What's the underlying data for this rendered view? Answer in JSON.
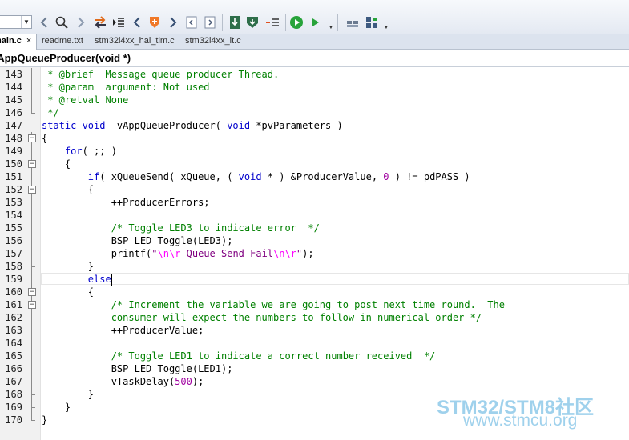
{
  "toolbar": {
    "search_value": "",
    "icons": [
      "back-arrow-icon",
      "find-icon",
      "forward-arrow-icon",
      "indent-icon",
      "outdent-icon",
      "nav-back-icon",
      "bookmark-shield-icon",
      "nav-forward-icon",
      "prev-bookmark-icon",
      "next-bookmark-icon",
      "download-icon",
      "debug-shield-icon",
      "step-icon",
      "run-icon",
      "run-to-cursor-icon",
      "window-layout-icon",
      "window-layout-add-icon"
    ]
  },
  "tabs": [
    {
      "label": "main.c",
      "active": true,
      "close": "×"
    },
    {
      "label": "readme.txt",
      "active": false
    },
    {
      "label": "stm32l4xx_hal_tim.c",
      "active": false
    },
    {
      "label": "stm32l4xx_it.c",
      "active": false
    }
  ],
  "function_bar": "vAppQueueProducer(void *)",
  "code_lines": [
    {
      "n": "143",
      "fold": "line",
      "segs": [
        {
          "t": " * @brief  Message queue producer Thread.",
          "c": "cm"
        }
      ]
    },
    {
      "n": "144",
      "fold": "line",
      "segs": [
        {
          "t": " * @param  argument: Not used",
          "c": "cm"
        }
      ]
    },
    {
      "n": "145",
      "fold": "line",
      "segs": [
        {
          "t": " * @retval None",
          "c": "cm"
        }
      ]
    },
    {
      "n": "146",
      "fold": "end",
      "segs": [
        {
          "t": " */",
          "c": "cm"
        }
      ]
    },
    {
      "n": "147",
      "fold": "none",
      "segs": [
        {
          "t": "static ",
          "c": "kw"
        },
        {
          "t": "void ",
          "c": "kw"
        },
        {
          "t": " vAppQueueProducer( ",
          "c": ""
        },
        {
          "t": "void",
          "c": "kw"
        },
        {
          "t": " *pvParameters )",
          "c": ""
        }
      ]
    },
    {
      "n": "148",
      "fold": "open",
      "segs": [
        {
          "t": "{",
          "c": ""
        }
      ]
    },
    {
      "n": "149",
      "fold": "line",
      "segs": [
        {
          "t": "    ",
          "c": ""
        },
        {
          "t": "for",
          "c": "kw"
        },
        {
          "t": "( ;; )",
          "c": ""
        }
      ]
    },
    {
      "n": "150",
      "fold": "open",
      "segs": [
        {
          "t": "    {",
          "c": ""
        }
      ]
    },
    {
      "n": "151",
      "fold": "line",
      "segs": [
        {
          "t": "        ",
          "c": ""
        },
        {
          "t": "if",
          "c": "kw"
        },
        {
          "t": "( xQueueSend( xQueue, ( ",
          "c": ""
        },
        {
          "t": "void",
          "c": "kw"
        },
        {
          "t": " * ) &ProducerValue, ",
          "c": ""
        },
        {
          "t": "0",
          "c": "nm"
        },
        {
          "t": " ) != pdPASS )",
          "c": ""
        }
      ]
    },
    {
      "n": "152",
      "fold": "open",
      "segs": [
        {
          "t": "        {",
          "c": ""
        }
      ]
    },
    {
      "n": "153",
      "fold": "line",
      "segs": [
        {
          "t": "            ++ProducerErrors;",
          "c": ""
        }
      ]
    },
    {
      "n": "154",
      "fold": "line",
      "segs": [
        {
          "t": "",
          "c": ""
        }
      ]
    },
    {
      "n": "155",
      "fold": "line",
      "segs": [
        {
          "t": "            ",
          "c": ""
        },
        {
          "t": "/* Toggle LED3 to indicate error  */",
          "c": "cm"
        }
      ]
    },
    {
      "n": "156",
      "fold": "line",
      "segs": [
        {
          "t": "            BSP_LED_Toggle(LED3);",
          "c": ""
        }
      ]
    },
    {
      "n": "157",
      "fold": "line",
      "segs": [
        {
          "t": "            printf(",
          "c": ""
        },
        {
          "t": "\"",
          "c": "st"
        },
        {
          "t": "\\n\\r",
          "c": "es"
        },
        {
          "t": " Queue Send Fail",
          "c": "st"
        },
        {
          "t": "\\n\\r",
          "c": "es"
        },
        {
          "t": "\"",
          "c": "st"
        },
        {
          "t": ");",
          "c": ""
        }
      ]
    },
    {
      "n": "158",
      "fold": "end",
      "segs": [
        {
          "t": "        }",
          "c": ""
        }
      ]
    },
    {
      "n": "159",
      "fold": "line",
      "current": true,
      "caret": true,
      "segs": [
        {
          "t": "        ",
          "c": ""
        },
        {
          "t": "else",
          "c": "kw"
        }
      ]
    },
    {
      "n": "160",
      "fold": "open",
      "segs": [
        {
          "t": "        {",
          "c": ""
        }
      ]
    },
    {
      "n": "161",
      "fold": "open",
      "segs": [
        {
          "t": "            ",
          "c": ""
        },
        {
          "t": "/* Increment the variable we are going to post next time round.  The",
          "c": "cm"
        }
      ]
    },
    {
      "n": "162",
      "fold": "line",
      "segs": [
        {
          "t": "            consumer will expect the numbers to follow in numerical order */",
          "c": "cm"
        }
      ]
    },
    {
      "n": "163",
      "fold": "line",
      "segs": [
        {
          "t": "            ++ProducerValue;",
          "c": ""
        }
      ]
    },
    {
      "n": "164",
      "fold": "line",
      "segs": [
        {
          "t": "",
          "c": ""
        }
      ]
    },
    {
      "n": "165",
      "fold": "line",
      "segs": [
        {
          "t": "            ",
          "c": ""
        },
        {
          "t": "/* Toggle LED1 to indicate a correct number received  */",
          "c": "cm"
        }
      ]
    },
    {
      "n": "166",
      "fold": "line",
      "segs": [
        {
          "t": "            BSP_LED_Toggle(LED1);",
          "c": ""
        }
      ]
    },
    {
      "n": "167",
      "fold": "line",
      "segs": [
        {
          "t": "            vTaskDelay(",
          "c": ""
        },
        {
          "t": "500",
          "c": "nm"
        },
        {
          "t": ");",
          "c": ""
        }
      ]
    },
    {
      "n": "168",
      "fold": "end",
      "segs": [
        {
          "t": "        }",
          "c": ""
        }
      ]
    },
    {
      "n": "169",
      "fold": "end",
      "segs": [
        {
          "t": "    }",
          "c": ""
        }
      ]
    },
    {
      "n": "170",
      "fold": "end",
      "segs": [
        {
          "t": "}",
          "c": ""
        }
      ]
    }
  ],
  "watermark": {
    "line1": "STM32/STM8社区",
    "line2": "www.stmcu.org"
  }
}
